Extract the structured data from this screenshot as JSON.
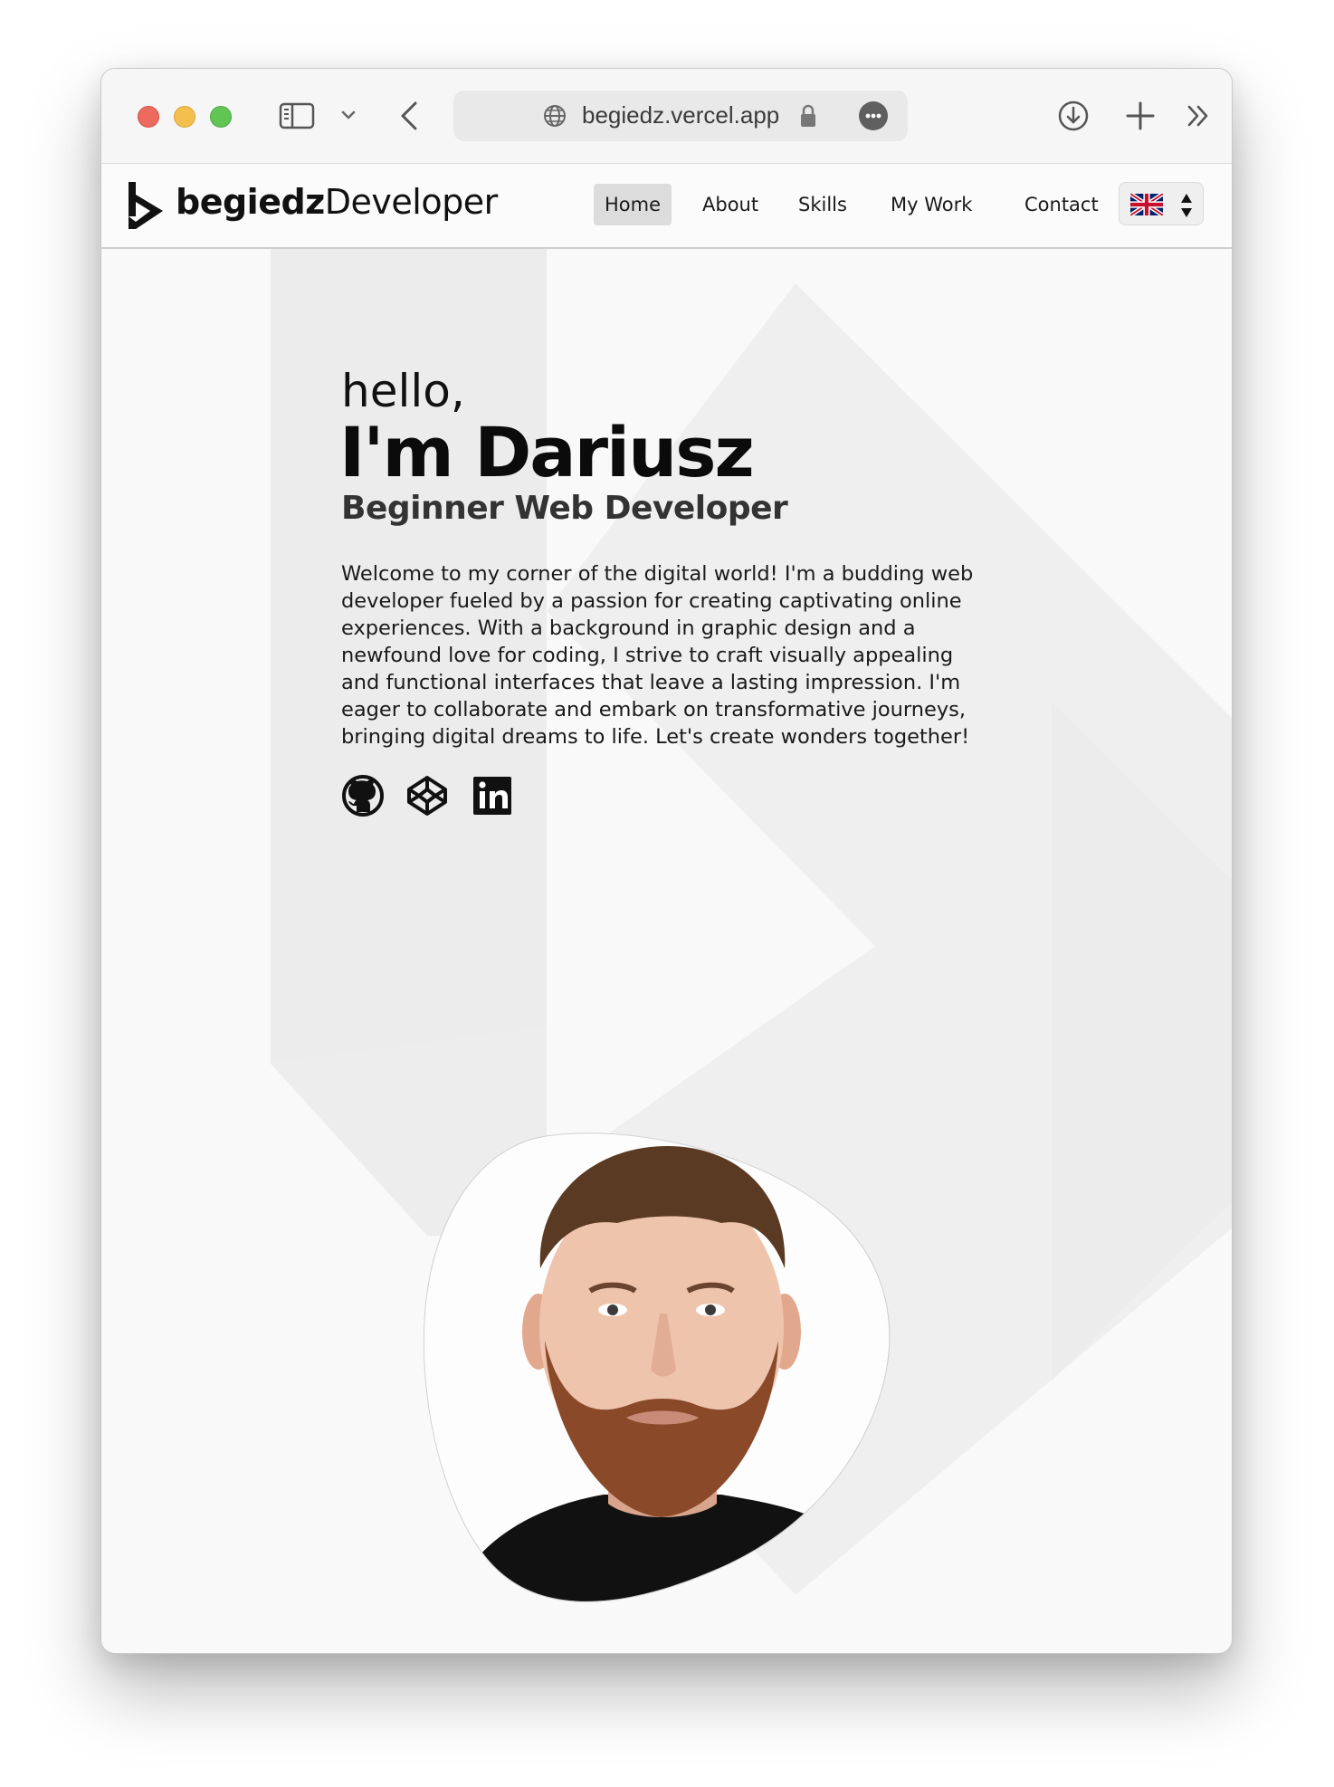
{
  "browser": {
    "url": "begiedz.vercel.app"
  },
  "site": {
    "logo_bold": "begiedz",
    "logo_light": "Developer",
    "nav": [
      {
        "label": "Home",
        "active": true
      },
      {
        "label": "About"
      },
      {
        "label": "Skills"
      },
      {
        "label": "My Work"
      },
      {
        "label": "Contact"
      }
    ],
    "language": "English (UK flag)"
  },
  "hero": {
    "greeting": "hello,",
    "name": "I'm Dariusz",
    "role": "Beginner Web Developer",
    "intro": "Welcome to my corner of the digital world! I'm a budding web developer fueled by a passion for creating captivating online experiences. With a background in graphic design and a newfound love for coding, I strive to craft visually appealing and functional interfaces that leave a lasting impression. I'm eager to collaborate and embark on transformative journeys, bringing digital dreams to life. Let's create wonders together!",
    "social": [
      "github-icon",
      "codepen-icon",
      "linkedin-icon"
    ]
  },
  "colors": {
    "page_bg": "#f9f9f9",
    "text": "#111111",
    "nav_active_bg": "#dcdcdc"
  }
}
